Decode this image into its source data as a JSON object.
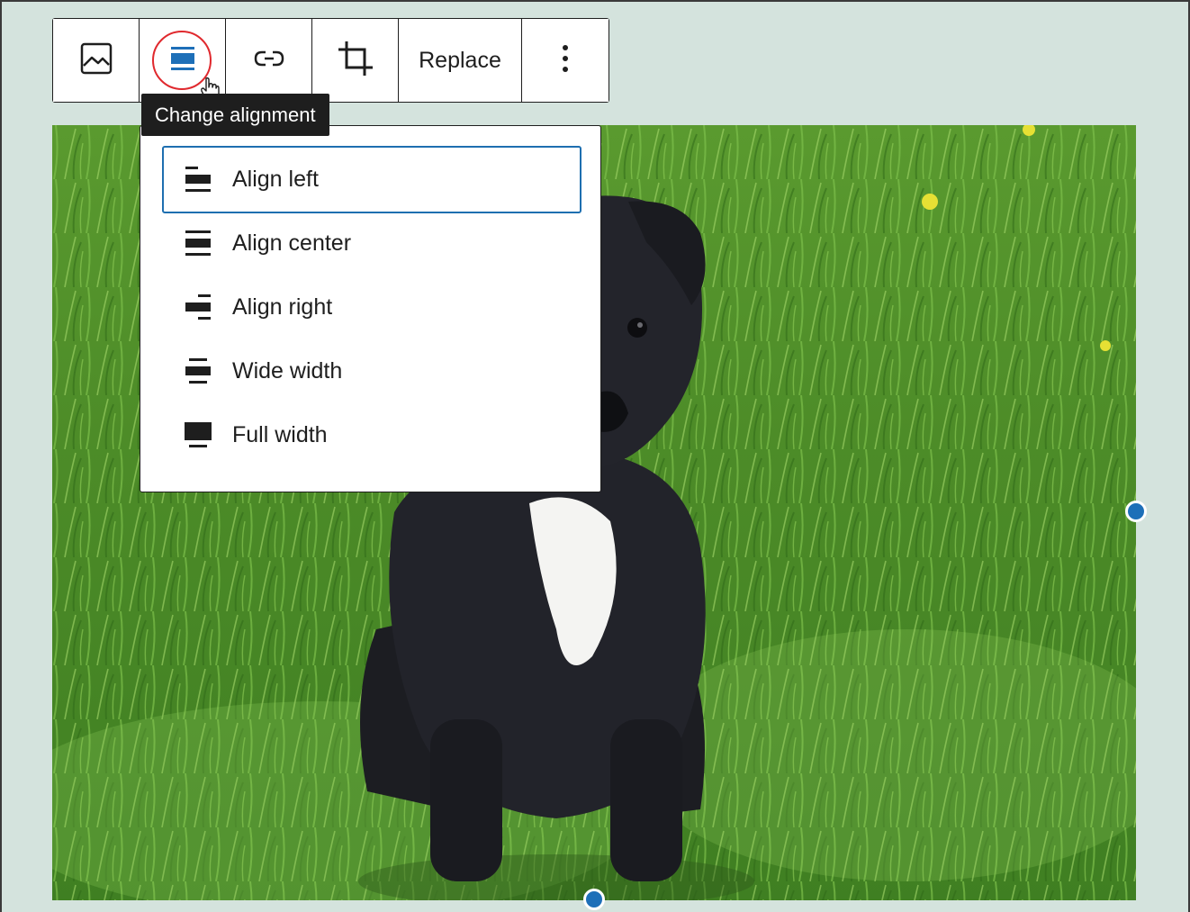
{
  "toolbar": {
    "buttons": [
      {
        "name": "image-icon",
        "label": ""
      },
      {
        "name": "align-center-icon",
        "label": ""
      },
      {
        "name": "link-icon",
        "label": ""
      },
      {
        "name": "crop-icon",
        "label": ""
      },
      {
        "name": "replace",
        "label": "Replace"
      },
      {
        "name": "more-options-icon",
        "label": ""
      }
    ],
    "replace_label": "Replace",
    "active_highlight_color": "#e0292e"
  },
  "tooltip": {
    "text": "Change alignment"
  },
  "align_menu": {
    "items": [
      {
        "label": "Align left",
        "icon": "align-left-icon",
        "selected": true
      },
      {
        "label": "Align center",
        "icon": "align-center-icon",
        "selected": false
      },
      {
        "label": "Align right",
        "icon": "align-right-icon",
        "selected": false
      },
      {
        "label": "Wide width",
        "icon": "align-wide-icon",
        "selected": false
      },
      {
        "label": "Full width",
        "icon": "align-full-icon",
        "selected": false
      }
    ],
    "focus_color": "#1e6fb0"
  },
  "colors": {
    "canvas_background": "#d4e3dd",
    "accent": "#1d6fb8",
    "text": "#1e1e1e"
  }
}
